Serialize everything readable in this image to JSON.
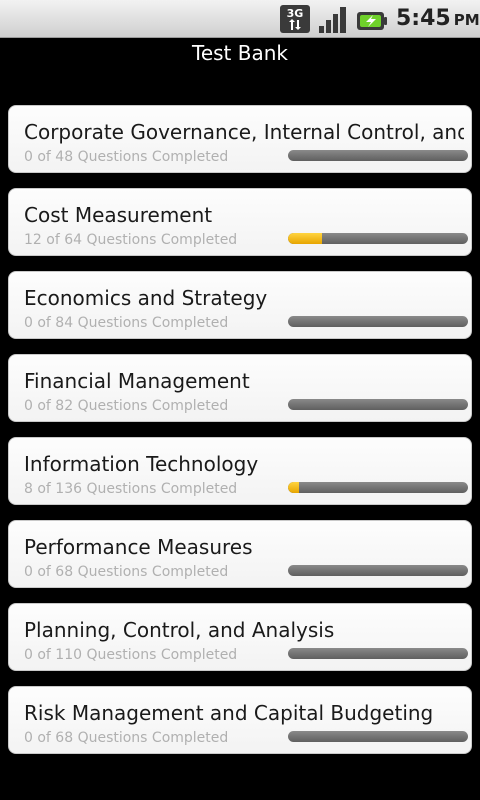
{
  "status_bar": {
    "network_icon": "3g-data-icon",
    "signal_icon": "signal-strength-icon",
    "battery_icon": "battery-charging-icon",
    "time": "5:45",
    "ampm": "PM"
  },
  "header": {
    "title": "Test Bank"
  },
  "colors": {
    "progress_fill": "#f2b800",
    "progress_track": "#6f6f6f",
    "card_background": "#f7f7f7"
  },
  "topics": [
    {
      "title": "Corporate Governance, Internal Control, and",
      "status": "0 of 48 Questions Completed",
      "completed": 0,
      "total": 48
    },
    {
      "title": "Cost Measurement",
      "status": "12 of 64 Questions Completed",
      "completed": 12,
      "total": 64
    },
    {
      "title": "Economics and Strategy",
      "status": "0 of 84 Questions Completed",
      "completed": 0,
      "total": 84
    },
    {
      "title": "Financial Management",
      "status": "0 of 82 Questions Completed",
      "completed": 0,
      "total": 82
    },
    {
      "title": "Information Technology",
      "status": "8 of 136 Questions Completed",
      "completed": 8,
      "total": 136
    },
    {
      "title": "Performance Measures",
      "status": "0 of 68 Questions Completed",
      "completed": 0,
      "total": 68
    },
    {
      "title": "Planning, Control, and Analysis",
      "status": "0 of 110 Questions Completed",
      "completed": 0,
      "total": 110
    },
    {
      "title": "Risk Management and Capital Budgeting",
      "status": "0 of 68 Questions Completed",
      "completed": 0,
      "total": 68
    }
  ]
}
